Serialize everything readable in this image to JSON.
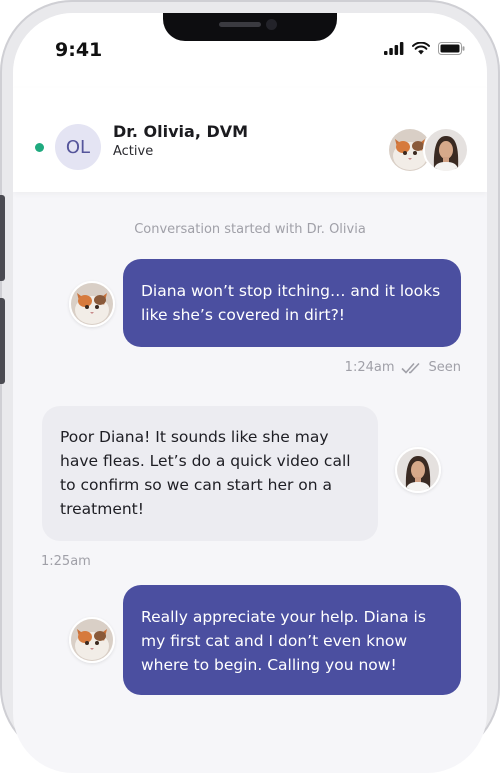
{
  "status_bar": {
    "time": "9:41"
  },
  "header": {
    "initials": "OL",
    "name": "Dr. Olivia, DVM",
    "status": "Active"
  },
  "conversation": {
    "started_label": "Conversation started with Dr. Olivia",
    "messages": [
      {
        "from": "user",
        "text": "Diana won’t stop itching… and it looks like she’s covered in dirt?!",
        "time": "1:24am",
        "receipt": "Seen"
      },
      {
        "from": "doctor",
        "text": "Poor Diana! It sounds like she may have fleas. Let’s do a quick video call to confirm so we can start her on a treatment!",
        "time": "1:25am"
      },
      {
        "from": "user",
        "text": "Really appreciate your help. Diana is my first cat and I don’t even know where to begin. Calling you now!"
      }
    ]
  },
  "colors": {
    "sent_bubble": "#4b4fa0",
    "received_bubble": "#ececf1",
    "online": "#1faa7f",
    "initials_bg": "#e4e4f3"
  },
  "icons": [
    "signal-icon",
    "wifi-icon",
    "battery-icon",
    "double-check-icon"
  ]
}
